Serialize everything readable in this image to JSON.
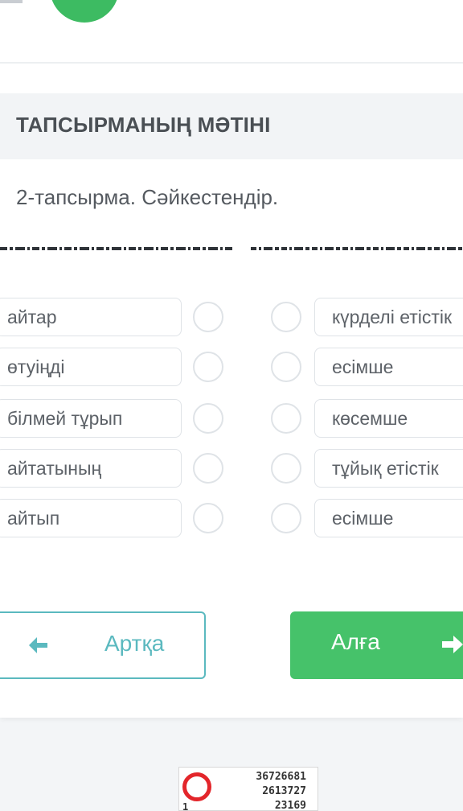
{
  "section": {
    "title": "ТАПСЫРМАНЫҢ МӘТІНІ"
  },
  "task": {
    "text": "2-тапсырма. Сәйкестендір."
  },
  "left_items": [
    {
      "label": "айтар"
    },
    {
      "label": "өтуіңді"
    },
    {
      "label": "білмей тұрып"
    },
    {
      "label": "айтатының"
    },
    {
      "label": "айтып"
    }
  ],
  "right_items": [
    {
      "label": "күрделі етістік"
    },
    {
      "label": "есімше"
    },
    {
      "label": "көсемше"
    },
    {
      "label": "тұйық етістік"
    },
    {
      "label": "есімше"
    }
  ],
  "buttons": {
    "back_label": "Артқа",
    "next_label": "Алға"
  },
  "counter": {
    "line1": "36726681",
    "line2": "2613727",
    "line3": "23169",
    "left_digit": "1"
  },
  "colors": {
    "accent_green": "#46c26a",
    "back_teal": "#5bb9bf",
    "counter_red": "#e3262b"
  },
  "icons": {
    "back": "arrow-left-icon",
    "next": "arrow-right-icon"
  }
}
